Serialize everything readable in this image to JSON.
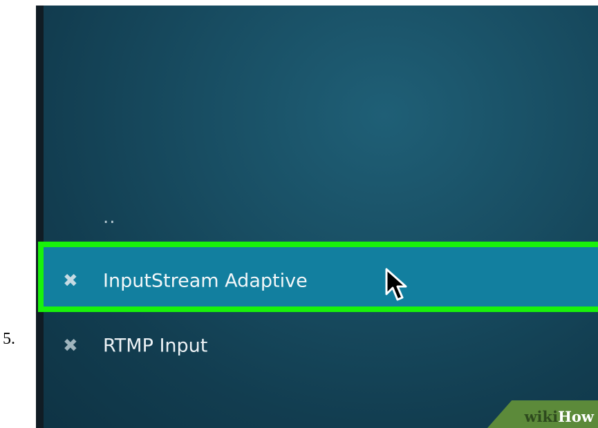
{
  "step": {
    "number": "5."
  },
  "file_list": {
    "parent_dir_label": "..",
    "items": [
      {
        "label": "InputStream Adaptive",
        "icon": "x-icon",
        "selected": true
      },
      {
        "label": "RTMP Input",
        "icon": "x-icon",
        "selected": false
      }
    ]
  },
  "watermark": {
    "part1": "wiki",
    "part2": "How"
  },
  "colors": {
    "background": "#184d62",
    "selected_row": "#127f9f",
    "highlight_border": "#19f20b",
    "watermark_green": "#5c8a3a"
  }
}
